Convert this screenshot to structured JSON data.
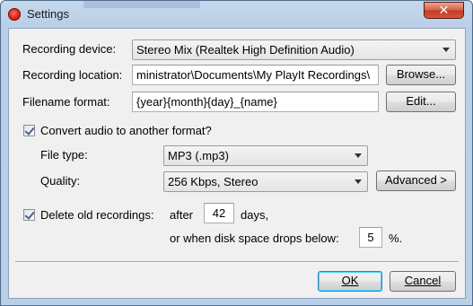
{
  "window": {
    "title": "Settings",
    "close_glyph": "✕"
  },
  "recording_device": {
    "label": "Recording device:",
    "value": "Stereo Mix (Realtek High Definition Audio)"
  },
  "recording_location": {
    "label": "Recording location:",
    "value": "ministrator\\Documents\\My PlayIt Recordings\\",
    "browse_label": "Browse..."
  },
  "filename_format": {
    "label": "Filename format:",
    "value": "{year}{month}{day}_{name}",
    "edit_label": "Edit..."
  },
  "convert": {
    "checkbox_label": "Convert audio to another format?",
    "checked": true,
    "file_type_label": "File type:",
    "file_type_value": "MP3 (.mp3)",
    "quality_label": "Quality:",
    "quality_value": "256 Kbps, Stereo",
    "advanced_label": "Advanced >"
  },
  "delete_old": {
    "checkbox_label": "Delete old recordings:",
    "checked": true,
    "after_label": "after",
    "days_value": "42",
    "days_label": "days,",
    "disk_label": "or when disk space drops below:",
    "percent_value": "5",
    "percent_label": "%."
  },
  "footer": {
    "ok_label": "OK",
    "cancel_label": "Cancel"
  },
  "colors": {
    "titlebar": "#bad0e8",
    "close": "#c9432a",
    "dialog_bg": "#f0f0f0",
    "checkmark": "#4a5f97"
  }
}
